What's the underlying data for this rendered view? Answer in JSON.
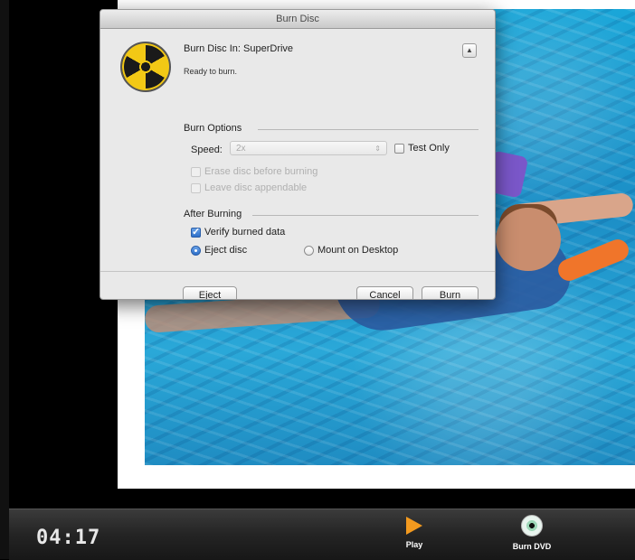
{
  "dialog": {
    "title": "Burn Disc",
    "burn_in": "Burn Disc In: SuperDrive",
    "status": "Ready to burn.",
    "disclosure": "▲",
    "burn_options_title": "Burn Options",
    "speed_label": "Speed:",
    "speed_value": "2x",
    "test_only_label": "Test Only",
    "erase_label": "Erase disc before burning",
    "appendable_label": "Leave disc appendable",
    "after_burning_title": "After Burning",
    "verify_label": "Verify burned data",
    "eject_disc_label": "Eject disc",
    "mount_label": "Mount on Desktop",
    "eject_button": "Eject",
    "cancel_button": "Cancel",
    "burn_button": "Burn"
  },
  "toolbar": {
    "time": "04:17",
    "play_label": "Play",
    "burn_dvd_label": "Burn DVD"
  },
  "colors": {
    "accent": "#2d6fc9",
    "play_icon": "#f39a1f"
  }
}
